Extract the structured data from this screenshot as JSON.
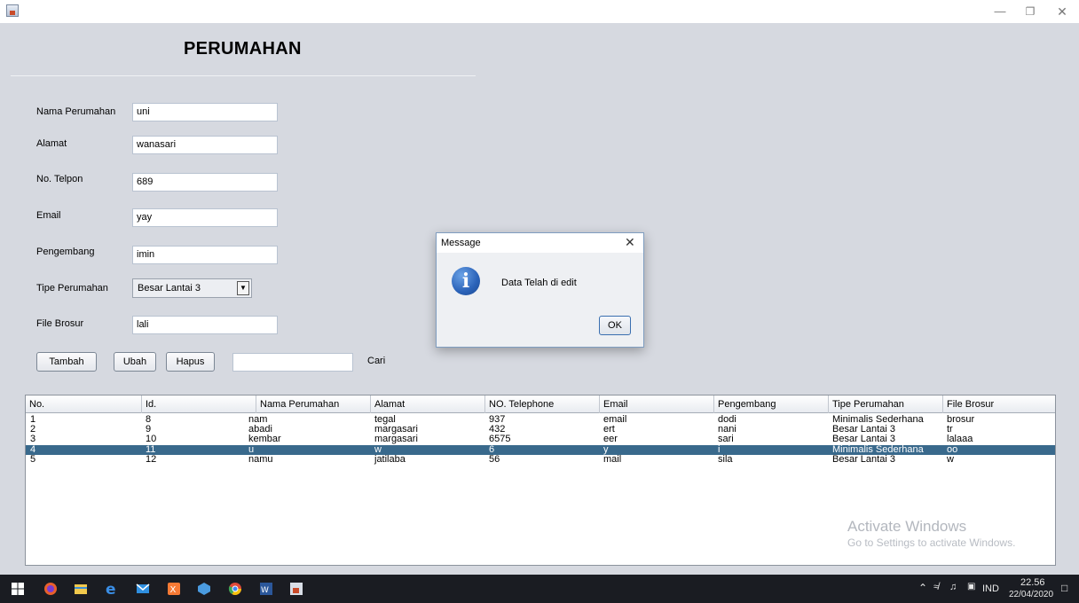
{
  "header": {
    "title": "PERUMAHAN"
  },
  "form": {
    "nama_perumahan": {
      "label": "Nama Perumahan",
      "value": "uni"
    },
    "alamat": {
      "label": "Alamat",
      "value": "wanasari"
    },
    "no_telpon": {
      "label": "No. Telpon",
      "value": "689"
    },
    "email": {
      "label": "Email",
      "value": "yay"
    },
    "pengembang": {
      "label": "Pengembang",
      "value": "imin"
    },
    "tipe_perumahan": {
      "label": "Tipe Perumahan",
      "value": "Besar Lantai 3"
    },
    "file_brosur": {
      "label": "File Brosur",
      "value": "lali"
    }
  },
  "buttons": {
    "tambah": "Tambah",
    "ubah": "Ubah",
    "hapus": "Hapus"
  },
  "search": {
    "label": "Cari",
    "value": ""
  },
  "table": {
    "columns": [
      "No.",
      "Id.",
      "Nama Perumahan",
      "Alamat",
      "NO. Telephone",
      "Email",
      "Pengembang",
      "Tipe Perumahan",
      "File Brosur"
    ],
    "rows": [
      [
        "1",
        "8",
        "nam",
        "tegal",
        "937",
        "email",
        "dodi",
        "Minimalis Sederhana",
        "brosur"
      ],
      [
        "2",
        "9",
        "abadi",
        "margasari",
        "432",
        "ert",
        "nani",
        "Besar Lantai 3",
        "tr"
      ],
      [
        "3",
        "10",
        "kembar",
        "margasari",
        "6575",
        "eer",
        "sari",
        "Besar Lantai 3",
        "lalaaa"
      ],
      [
        "4",
        "11",
        "u",
        "w",
        "6",
        "y",
        "i",
        "Minimalis Sederhana",
        "oo"
      ],
      [
        "5",
        "12",
        "namu",
        "jatilaba",
        "56",
        "mail",
        "sila",
        "Besar Lantai 3",
        "w"
      ]
    ],
    "selected_row": 3
  },
  "dialog": {
    "title": "Message",
    "message": "Data Telah di edit",
    "ok_label": "OK"
  },
  "watermark": {
    "title": "Activate Windows",
    "subtitle": "Go to Settings to activate Windows."
  },
  "taskbar": {
    "language": "IND",
    "time": "22.56",
    "date": "22/04/2020"
  },
  "colors": {
    "selection": "#39698c",
    "background": "#d6d9e0",
    "taskbar": "#1a1c22"
  }
}
